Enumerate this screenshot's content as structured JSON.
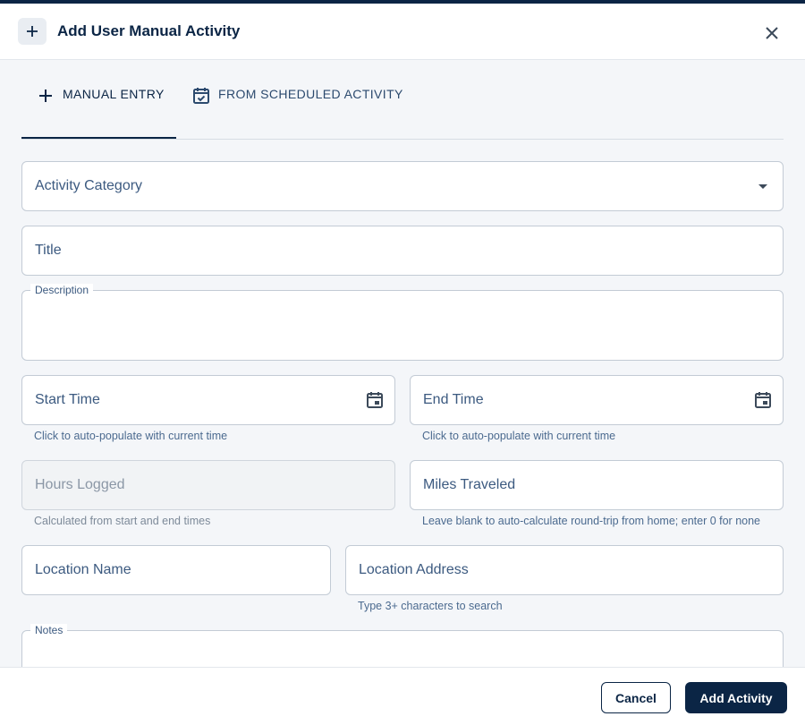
{
  "dialog": {
    "title": "Add User Manual Activity",
    "header_icon": "plus-icon",
    "close_icon": "close-icon"
  },
  "tabs": [
    {
      "label": "MANUAL ENTRY",
      "icon": "plus-icon",
      "active": true
    },
    {
      "label": "FROM SCHEDULED ACTIVITY",
      "icon": "calendar-check-icon",
      "active": false
    }
  ],
  "form": {
    "activity_category": {
      "label": "Activity Category",
      "value": ""
    },
    "title": {
      "label": "Title",
      "value": ""
    },
    "description": {
      "label": "Description",
      "value": ""
    },
    "start_time": {
      "label": "Start Time",
      "helper": "Click to auto-populate with current time",
      "icon": "calendar-icon"
    },
    "end_time": {
      "label": "End Time",
      "helper": "Click to auto-populate with current time",
      "icon": "calendar-icon"
    },
    "hours_logged": {
      "label": "Hours Logged",
      "helper": "Calculated from start and end times",
      "disabled": true
    },
    "miles_traveled": {
      "label": "Miles Traveled",
      "helper": "Leave blank to auto-calculate round-trip from home; enter 0 for none"
    },
    "location_name": {
      "label": "Location Name"
    },
    "location_address": {
      "label": "Location Address",
      "helper": "Type 3+ characters to search"
    },
    "notes": {
      "label": "Notes"
    }
  },
  "footer": {
    "cancel_label": "Cancel",
    "submit_label": "Add Activity"
  },
  "colors": {
    "primary": "#0b2545",
    "accent_text": "#2c4a6e",
    "border": "#c3cbd5",
    "background": "#f4f6f9"
  }
}
